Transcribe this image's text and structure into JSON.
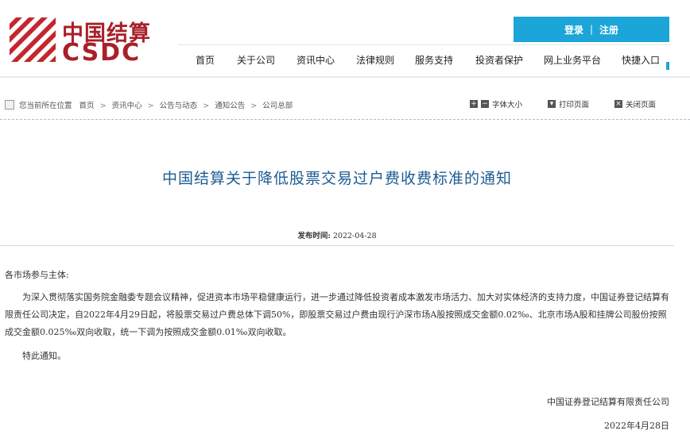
{
  "header": {
    "logo_cn": "中国结算",
    "logo_en": "CSDC",
    "login_label": "登录",
    "login_separator": "|",
    "register_label": "注册",
    "accent_color": "#1ba5d8",
    "brand_color": "#a8202a"
  },
  "nav": {
    "items": [
      {
        "label": "首页"
      },
      {
        "label": "关于公司"
      },
      {
        "label": "资讯中心"
      },
      {
        "label": "法律规则"
      },
      {
        "label": "服务支持"
      },
      {
        "label": "投资者保护"
      },
      {
        "label": "网上业务平台"
      },
      {
        "label": "快捷入口"
      }
    ]
  },
  "breadcrumb": {
    "prefix": "您当前所在位置",
    "items": [
      "首页",
      "资讯中心",
      "公告与动态",
      "通知公告",
      "公司总部"
    ],
    "separator": ">"
  },
  "tools": {
    "font_size": "字体大小",
    "print": "打印页面",
    "close": "关闭页面"
  },
  "article": {
    "title": "中国结算关于降低股票交易过户费收费标准的通知",
    "publish_label": "发布时间:",
    "publish_date": "2022-04-28",
    "salutation": "各市场参与主体:",
    "body": "为深入贯彻落实国务院金融委专题会议精神，促进资本市场平稳健康运行，进一步通过降低投资者成本激发市场活力、加大对实体经济的支持力度，中国证券登记结算有限责任公司决定，自2022年4月29日起，将股票交易过户费总体下调50%，即股票交易过户费由现行沪深市场A股按照成交金额0.02‰、北京市场A股和挂牌公司股份按照成交金额0.025‰双向收取，统一下调为按照成交金额0.01‰双向收取。",
    "closing": "特此通知。",
    "signer": "中国证券登记结算有限责任公司",
    "sign_date": "2022年4月28日"
  }
}
